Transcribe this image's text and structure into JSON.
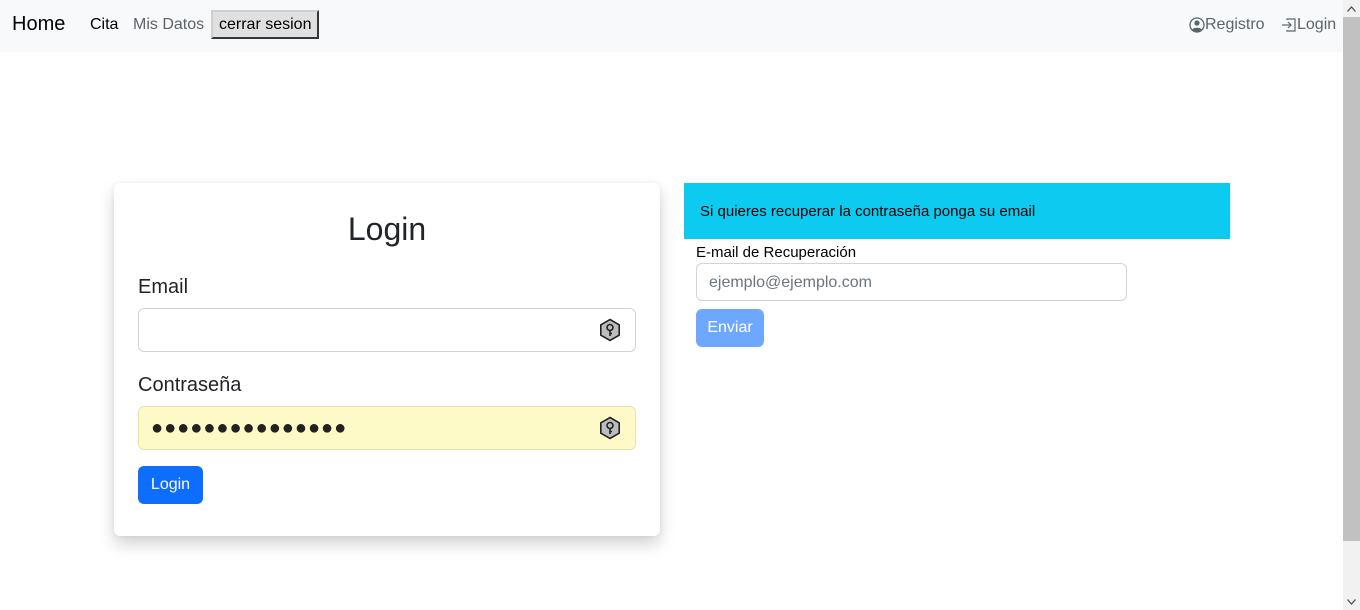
{
  "navbar": {
    "brand": "Home",
    "links": {
      "cita": "Cita",
      "mis_datos": "Mis Datos"
    },
    "logout_button": "cerrar sesion",
    "registro": "Registro",
    "login": "Login"
  },
  "login_card": {
    "title": "Login",
    "email_label": "Email",
    "email_value": "",
    "password_label": "Contraseña",
    "password_masked": "●●●●●●●●●●●●●●●",
    "submit": "Login"
  },
  "recovery": {
    "alert_text": "Si quieres recuperar la contraseña ponga su email",
    "email_label": "E-mail de Recuperación",
    "email_placeholder": "ejemplo@ejemplo.com",
    "submit": "Enviar"
  },
  "icons": {
    "registro": "person-circle-icon",
    "login": "box-arrow-in-right-icon",
    "password_manager": "key-icon"
  },
  "colors": {
    "primary": "#0d6efd",
    "primary_disabled": "#6ea8fe",
    "info": "#0dcaf0",
    "autofill": "#fefac8",
    "navbar_bg": "#f8f9fa"
  }
}
